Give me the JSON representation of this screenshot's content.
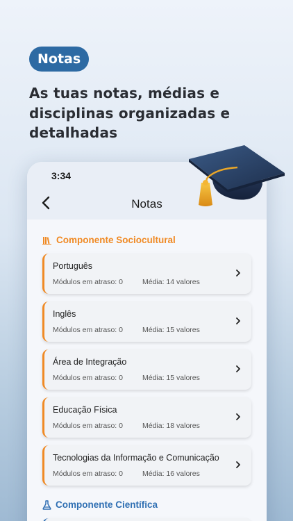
{
  "badge": "Notas",
  "headline": "As tuas notas, médias e disciplinas organizadas e detalhadas",
  "phone": {
    "status_time": "3:34",
    "nav_title": "Notas"
  },
  "sections": [
    {
      "title": "Componente Sociocultural",
      "icon": "library-icon",
      "color": "#f08a24",
      "subjects": [
        {
          "name": "Português",
          "late": "Módulos em atraso: 0",
          "avg": "Média: 14 valores"
        },
        {
          "name": "Inglês",
          "late": "Módulos em atraso: 0",
          "avg": "Média: 15 valores"
        },
        {
          "name": "Área de Integração",
          "late": "Módulos em atraso: 0",
          "avg": "Média: 15 valores"
        },
        {
          "name": "Educação Física",
          "late": "Módulos em atraso: 0",
          "avg": "Média: 18 valores"
        },
        {
          "name": "Tecnologias da Informação e Comunicação",
          "late": "Módulos em atraso: 0",
          "avg": "Média: 16 valores"
        }
      ]
    },
    {
      "title": "Componente Científica",
      "icon": "flask-icon",
      "color": "#2f6fb3"
    }
  ],
  "colors": {
    "badge_bg": "#2d6aa3",
    "accent_orange": "#f08a24",
    "accent_blue": "#2f6fb3"
  }
}
